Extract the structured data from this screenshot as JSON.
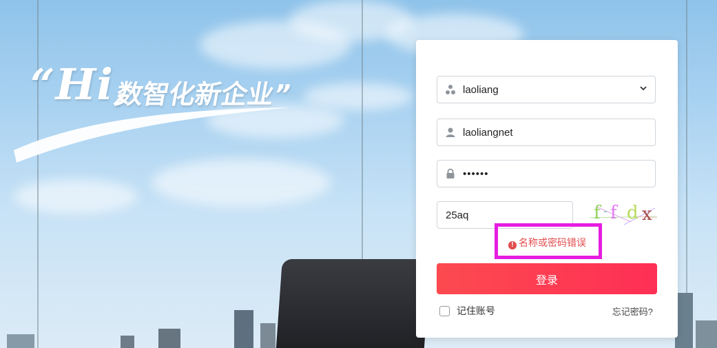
{
  "background": {
    "slogan_quote_open": "“",
    "slogan_hi": "Hi",
    "slogan_comma": ",",
    "slogan_cn": "数智化新企业",
    "slogan_quote_close": "”"
  },
  "login": {
    "org_select": {
      "value": "laoliang",
      "icon": "org-icon"
    },
    "username": {
      "value": "laoliangnet",
      "icon": "user-icon"
    },
    "password": {
      "value": "••••••",
      "icon": "lock-icon"
    },
    "captcha_input": {
      "value": "25aq"
    },
    "captcha_image": {
      "chars": [
        "f",
        "-",
        "f",
        "d",
        "x"
      ]
    },
    "error_message": "名称或密码错误",
    "login_button": "登录",
    "remember_label": "记住账号",
    "forgot_link": "忘记密码?"
  },
  "colors": {
    "accent": "#ff3b50",
    "error": "#e24c4c",
    "highlight_box": "#e61de0"
  }
}
